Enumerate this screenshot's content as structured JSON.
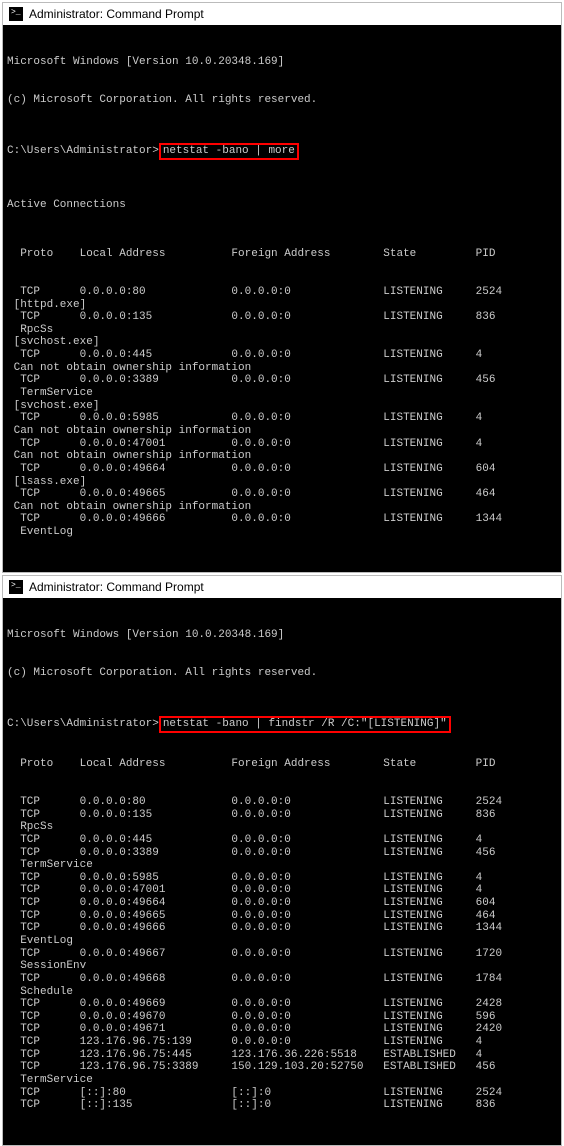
{
  "window1": {
    "title": "Administrator: Command Prompt",
    "banner_line1": "Microsoft Windows [Version 10.0.20348.169]",
    "banner_line2": "(c) Microsoft Corporation. All rights reserved.",
    "prompt": "C:\\Users\\Administrator>",
    "command": "netstat -bano | more",
    "section_title": "Active Connections",
    "header": {
      "proto": "Proto",
      "local": "Local Address",
      "foreign": "Foreign Address",
      "state": "State",
      "pid": "PID"
    },
    "rows": [
      {
        "proto": "TCP",
        "local": "0.0.0.0:80",
        "foreign": "0.0.0.0:0",
        "state": "LISTENING",
        "pid": "2524"
      },
      {
        "text": " [httpd.exe]"
      },
      {
        "proto": "TCP",
        "local": "0.0.0.0:135",
        "foreign": "0.0.0.0:0",
        "state": "LISTENING",
        "pid": "836"
      },
      {
        "text": "  RpcSs"
      },
      {
        "text": " [svchost.exe]"
      },
      {
        "proto": "TCP",
        "local": "0.0.0.0:445",
        "foreign": "0.0.0.0:0",
        "state": "LISTENING",
        "pid": "4"
      },
      {
        "text": " Can not obtain ownership information"
      },
      {
        "proto": "TCP",
        "local": "0.0.0.0:3389",
        "foreign": "0.0.0.0:0",
        "state": "LISTENING",
        "pid": "456"
      },
      {
        "text": "  TermService"
      },
      {
        "text": " [svchost.exe]"
      },
      {
        "proto": "TCP",
        "local": "0.0.0.0:5985",
        "foreign": "0.0.0.0:0",
        "state": "LISTENING",
        "pid": "4"
      },
      {
        "text": " Can not obtain ownership information"
      },
      {
        "proto": "TCP",
        "local": "0.0.0.0:47001",
        "foreign": "0.0.0.0:0",
        "state": "LISTENING",
        "pid": "4"
      },
      {
        "text": " Can not obtain ownership information"
      },
      {
        "proto": "TCP",
        "local": "0.0.0.0:49664",
        "foreign": "0.0.0.0:0",
        "state": "LISTENING",
        "pid": "604"
      },
      {
        "text": " [lsass.exe]"
      },
      {
        "proto": "TCP",
        "local": "0.0.0.0:49665",
        "foreign": "0.0.0.0:0",
        "state": "LISTENING",
        "pid": "464"
      },
      {
        "text": " Can not obtain ownership information"
      },
      {
        "proto": "TCP",
        "local": "0.0.0.0:49666",
        "foreign": "0.0.0.0:0",
        "state": "LISTENING",
        "pid": "1344"
      },
      {
        "text": "  EventLog"
      }
    ]
  },
  "window2": {
    "title": "Administrator: Command Prompt",
    "banner_line1": "Microsoft Windows [Version 10.0.20348.169]",
    "banner_line2": "(c) Microsoft Corporation. All rights reserved.",
    "prompt": "C:\\Users\\Administrator>",
    "command": "netstat -bano | findstr /R /C:\"[LISTENING]\"",
    "header": {
      "proto": "Proto",
      "local": "Local Address",
      "foreign": "Foreign Address",
      "state": "State",
      "pid": "PID"
    },
    "rows": [
      {
        "proto": "TCP",
        "local": "0.0.0.0:80",
        "foreign": "0.0.0.0:0",
        "state": "LISTENING",
        "pid": "2524"
      },
      {
        "proto": "TCP",
        "local": "0.0.0.0:135",
        "foreign": "0.0.0.0:0",
        "state": "LISTENING",
        "pid": "836"
      },
      {
        "text": "  RpcSs"
      },
      {
        "proto": "TCP",
        "local": "0.0.0.0:445",
        "foreign": "0.0.0.0:0",
        "state": "LISTENING",
        "pid": "4"
      },
      {
        "proto": "TCP",
        "local": "0.0.0.0:3389",
        "foreign": "0.0.0.0:0",
        "state": "LISTENING",
        "pid": "456"
      },
      {
        "text": "  TermService"
      },
      {
        "proto": "TCP",
        "local": "0.0.0.0:5985",
        "foreign": "0.0.0.0:0",
        "state": "LISTENING",
        "pid": "4"
      },
      {
        "proto": "TCP",
        "local": "0.0.0.0:47001",
        "foreign": "0.0.0.0:0",
        "state": "LISTENING",
        "pid": "4"
      },
      {
        "proto": "TCP",
        "local": "0.0.0.0:49664",
        "foreign": "0.0.0.0:0",
        "state": "LISTENING",
        "pid": "604"
      },
      {
        "proto": "TCP",
        "local": "0.0.0.0:49665",
        "foreign": "0.0.0.0:0",
        "state": "LISTENING",
        "pid": "464"
      },
      {
        "proto": "TCP",
        "local": "0.0.0.0:49666",
        "foreign": "0.0.0.0:0",
        "state": "LISTENING",
        "pid": "1344"
      },
      {
        "text": "  EventLog"
      },
      {
        "proto": "TCP",
        "local": "0.0.0.0:49667",
        "foreign": "0.0.0.0:0",
        "state": "LISTENING",
        "pid": "1720"
      },
      {
        "text": "  SessionEnv"
      },
      {
        "proto": "TCP",
        "local": "0.0.0.0:49668",
        "foreign": "0.0.0.0:0",
        "state": "LISTENING",
        "pid": "1784"
      },
      {
        "text": "  Schedule"
      },
      {
        "proto": "TCP",
        "local": "0.0.0.0:49669",
        "foreign": "0.0.0.0:0",
        "state": "LISTENING",
        "pid": "2428"
      },
      {
        "proto": "TCP",
        "local": "0.0.0.0:49670",
        "foreign": "0.0.0.0:0",
        "state": "LISTENING",
        "pid": "596"
      },
      {
        "proto": "TCP",
        "local": "0.0.0.0:49671",
        "foreign": "0.0.0.0:0",
        "state": "LISTENING",
        "pid": "2420"
      },
      {
        "proto": "TCP",
        "local": "123.176.96.75:139",
        "foreign": "0.0.0.0:0",
        "state": "LISTENING",
        "pid": "4"
      },
      {
        "proto": "TCP",
        "local": "123.176.96.75:445",
        "foreign": "123.176.36.226:5518",
        "state": "ESTABLISHED",
        "pid": "4"
      },
      {
        "proto": "TCP",
        "local": "123.176.96.75:3389",
        "foreign": "150.129.103.20:52750",
        "state": "ESTABLISHED",
        "pid": "456"
      },
      {
        "text": "  TermService"
      },
      {
        "proto": "TCP",
        "local": "[::]:80",
        "foreign": "[::]:0",
        "state": "LISTENING",
        "pid": "2524"
      },
      {
        "proto": "TCP",
        "local": "[::]:135",
        "foreign": "[::]:0",
        "state": "LISTENING",
        "pid": "836"
      }
    ]
  },
  "col_widths": {
    "proto": 9,
    "local": 23,
    "foreign": 23,
    "state": 14
  }
}
